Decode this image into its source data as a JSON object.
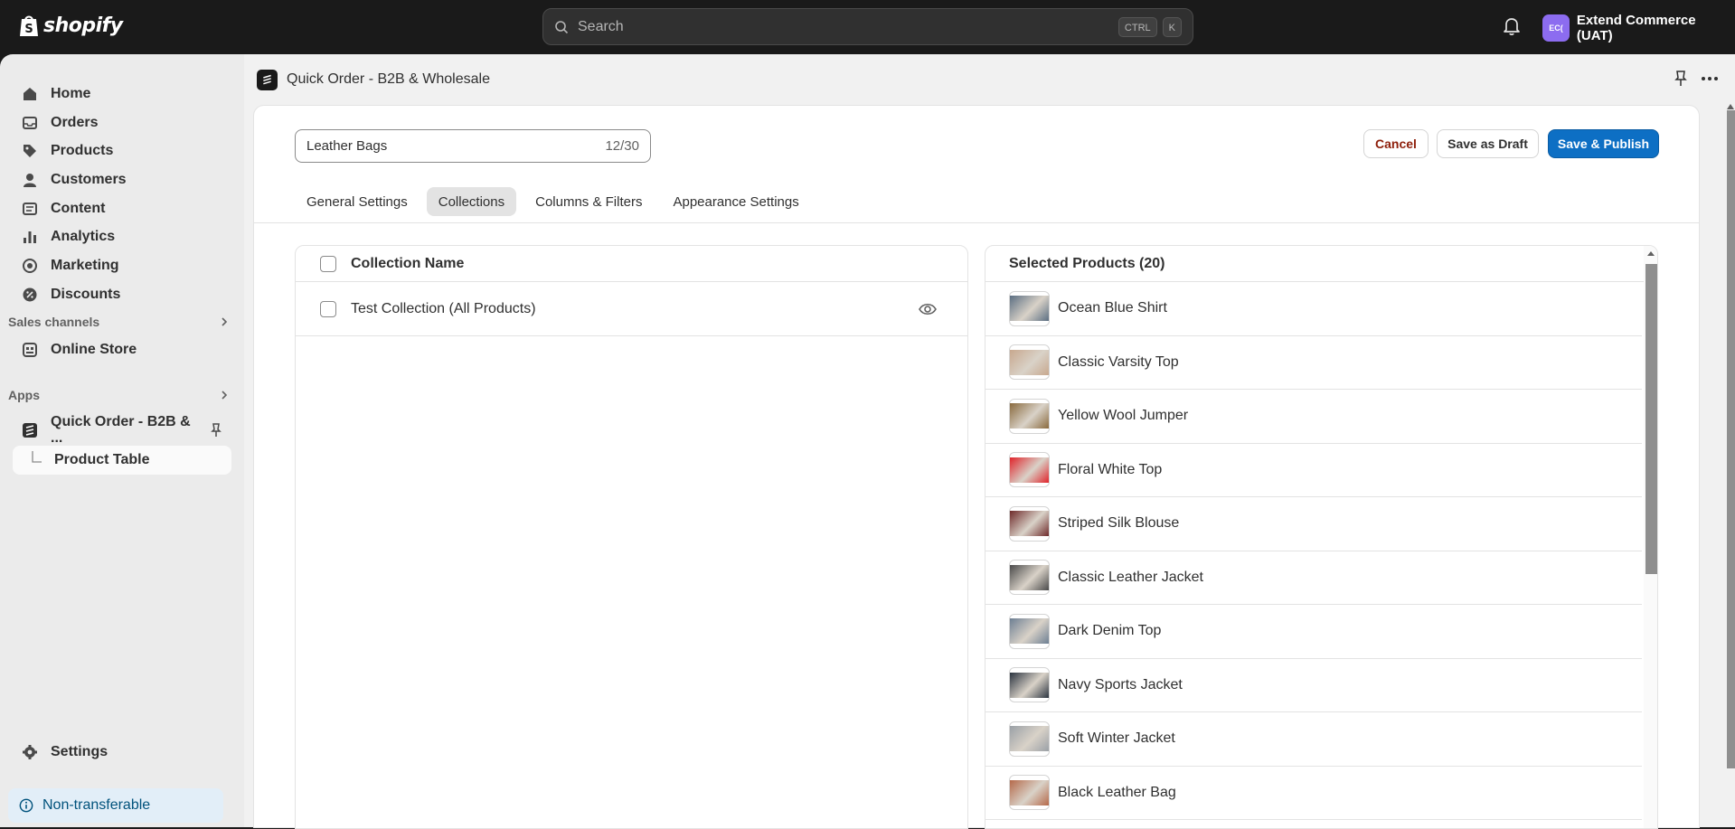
{
  "topbar": {
    "logo_text": "shopify",
    "search_placeholder": "Search",
    "shortcut_keys": [
      "CTRL",
      "K"
    ],
    "store_initials": "EC(",
    "store_name": "Extend Commerce (UAT)"
  },
  "sidebar": {
    "items": [
      {
        "label": "Home",
        "icon": "home-icon"
      },
      {
        "label": "Orders",
        "icon": "orders-icon"
      },
      {
        "label": "Products",
        "icon": "tag-icon"
      },
      {
        "label": "Customers",
        "icon": "person-icon"
      },
      {
        "label": "Content",
        "icon": "content-icon"
      },
      {
        "label": "Analytics",
        "icon": "chart-icon"
      },
      {
        "label": "Marketing",
        "icon": "target-icon"
      },
      {
        "label": "Discounts",
        "icon": "discount-icon"
      }
    ],
    "sales_channels_label": "Sales channels",
    "online_store_label": "Online Store",
    "apps_label": "Apps",
    "app_item_label": "Quick Order - B2B & ...",
    "app_sub_item_label": "Product Table",
    "settings_label": "Settings",
    "notice_label": "Non-transferable"
  },
  "app": {
    "title": "Quick Order - B2B & Wholesale",
    "name_field_value": "Leather Bags",
    "name_char_count": "12/30",
    "buttons": {
      "cancel": "Cancel",
      "save_draft": "Save as Draft",
      "save_publish": "Save & Publish"
    },
    "tabs": [
      {
        "label": "General Settings",
        "active": false
      },
      {
        "label": "Collections",
        "active": true
      },
      {
        "label": "Columns & Filters",
        "active": false
      },
      {
        "label": "Appearance Settings",
        "active": false
      }
    ],
    "collections_panel": {
      "header": "Collection Name",
      "rows": [
        "Test Collection (All Products)"
      ]
    },
    "products_panel": {
      "header": "Selected Products (20)",
      "products": [
        {
          "name": "Ocean Blue Shirt",
          "thumb_color": "#5b6e82"
        },
        {
          "name": "Classic Varsity Top",
          "thumb_color": "#c8a88e"
        },
        {
          "name": "Yellow Wool Jumper",
          "thumb_color": "#8a6a3e"
        },
        {
          "name": "Floral White Top",
          "thumb_color": "#e0242b"
        },
        {
          "name": "Striped Silk Blouse",
          "thumb_color": "#6e2a2a"
        },
        {
          "name": "Classic Leather Jacket",
          "thumb_color": "#4a4a4a"
        },
        {
          "name": "Dark Denim Top",
          "thumb_color": "#6d7f93"
        },
        {
          "name": "Navy Sports Jacket",
          "thumb_color": "#2b3440"
        },
        {
          "name": "Soft Winter Jacket",
          "thumb_color": "#9aa0a6"
        },
        {
          "name": "Black Leather Bag",
          "thumb_color": "#b5694a"
        }
      ]
    }
  },
  "colors": {
    "topbar_bg": "#1a1a1a",
    "sidebar_bg": "#ebebeb",
    "primary_button": "#0d6fc4",
    "cancel_text": "#8e1f0b",
    "notice_bg": "#e2eef8"
  }
}
